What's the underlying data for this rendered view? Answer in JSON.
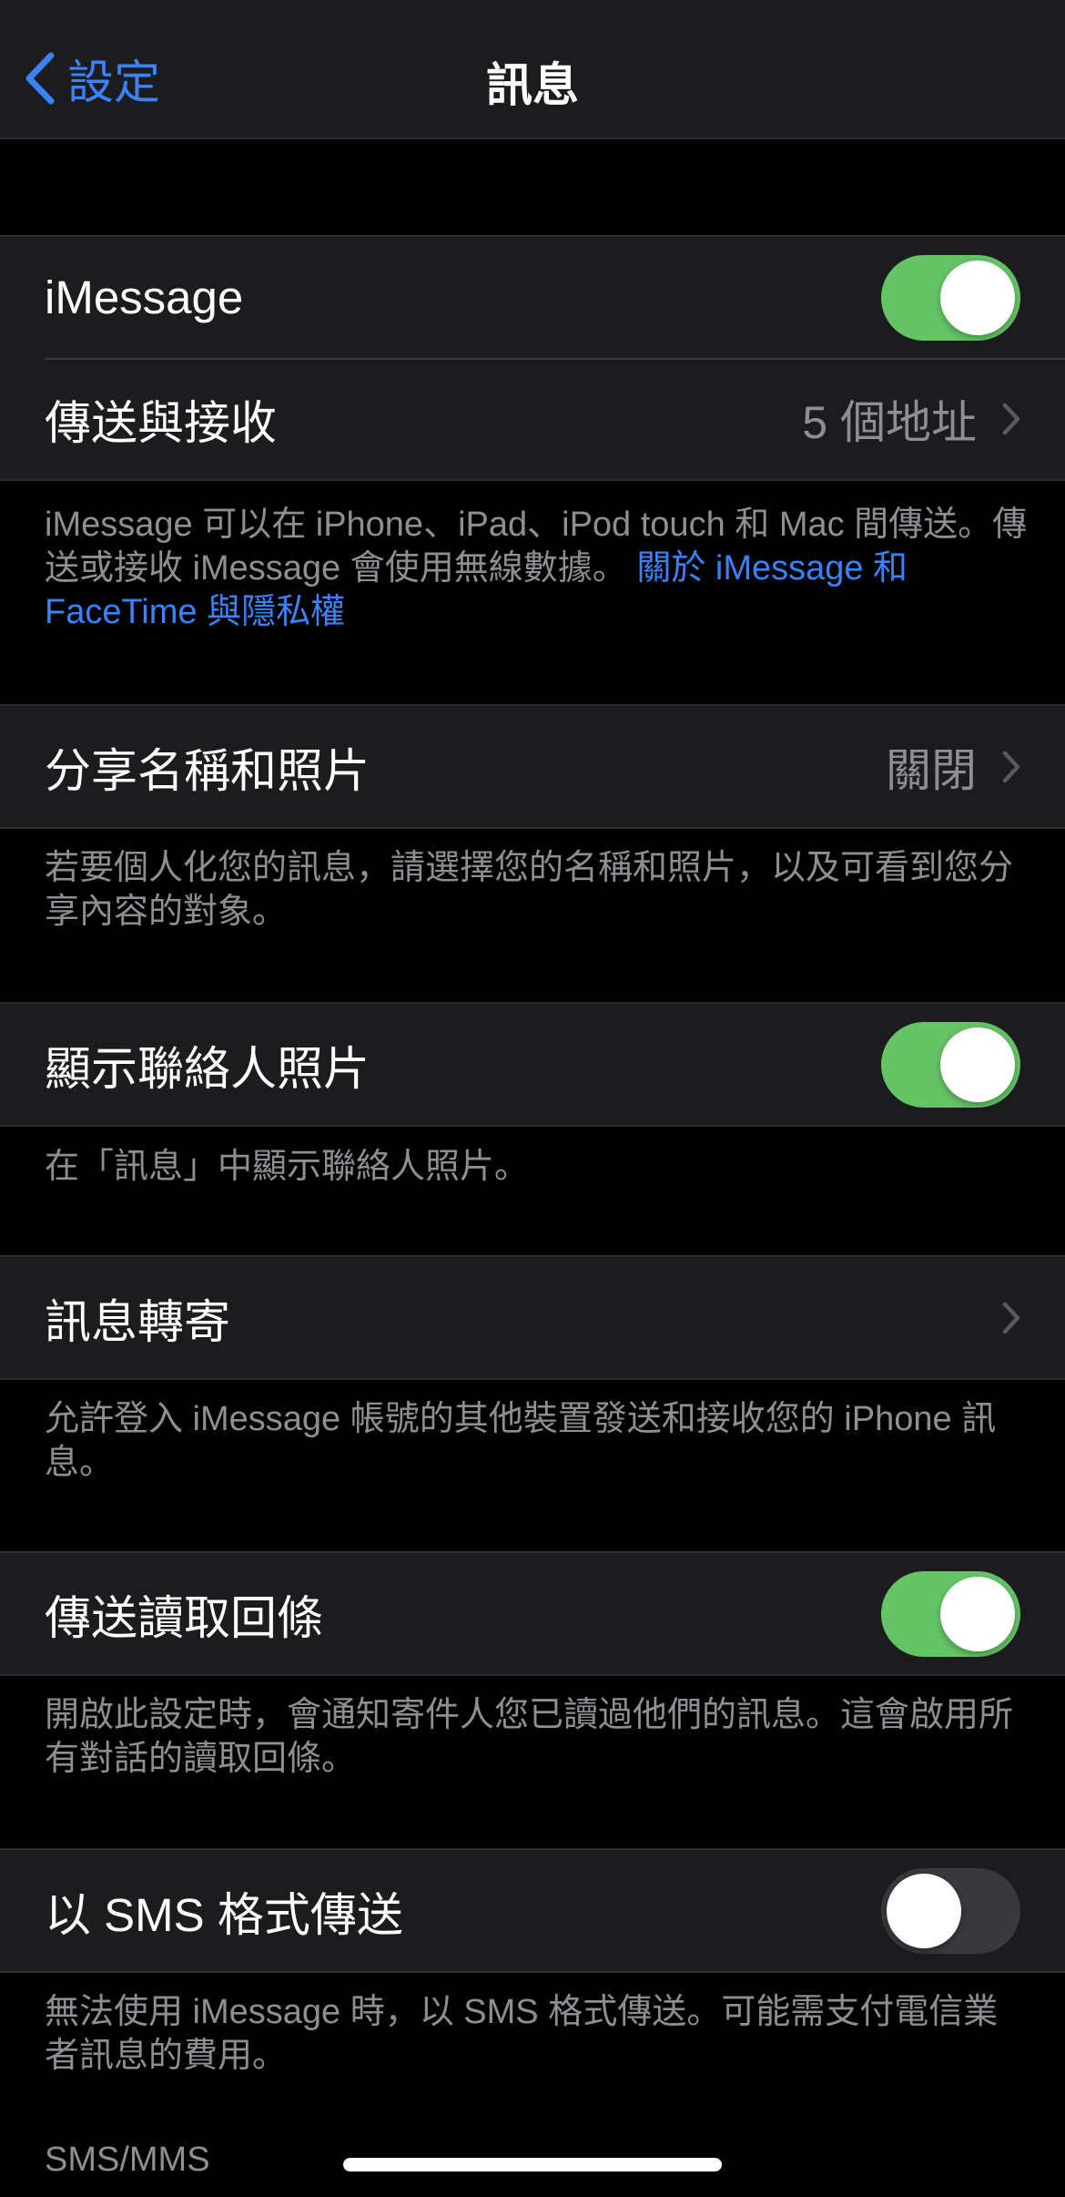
{
  "nav": {
    "back_label": "設定",
    "title": "訊息"
  },
  "imessage": {
    "label": "iMessage",
    "enabled": true
  },
  "send_receive": {
    "label": "傳送與接收",
    "value": "5 個地址"
  },
  "imessage_footer": {
    "text": "iMessage 可以在 iPhone、iPad、iPod touch 和 Mac 間傳送。傳送或接收 iMessage 會使用無線數據。 ",
    "link": "關於 iMessage 和 FaceTime 與隱私權"
  },
  "share_name_photo": {
    "label": "分享名稱和照片",
    "value": "關閉"
  },
  "share_footer": "若要個人化您的訊息，請選擇您的名稱和照片，以及可看到您分享內容的對象。",
  "show_contact_photos": {
    "label": "顯示聯絡人照片",
    "enabled": true
  },
  "contact_photos_footer": "在「訊息」中顯示聯絡人照片。",
  "text_forwarding": {
    "label": "訊息轉寄"
  },
  "forwarding_footer": "允許登入 iMessage 帳號的其他裝置發送和接收您的 iPhone 訊息。",
  "read_receipts": {
    "label": "傳送讀取回條",
    "enabled": true
  },
  "read_receipts_footer": "開啟此設定時，會通知寄件人您已讀過他們的訊息。這會啟用所有對話的讀取回條。",
  "send_as_sms": {
    "label": "以 SMS 格式傳送",
    "enabled": false
  },
  "sms_footer": "無法使用 iMessage 時，以 SMS 格式傳送。可能需支付電信業者訊息的費用。",
  "sms_mms_header": "SMS/MMS",
  "colors": {
    "accent": "#3a82f7",
    "toggle_on": "#65c466",
    "toggle_off": "#39393d",
    "cell_background": "#1c1c1e",
    "secondary_text": "#8e8e93"
  }
}
